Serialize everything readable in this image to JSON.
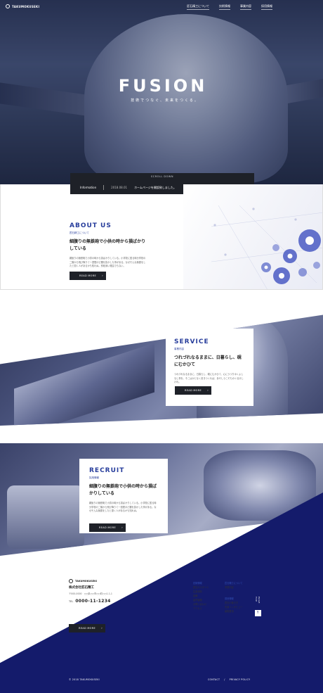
{
  "brand": {
    "logo_text": "TAKUMOKUSEKI"
  },
  "nav": {
    "items": [
      "匠石精工について",
      "技術情報",
      "事業内容",
      "採用情報"
    ]
  },
  "hero": {
    "title": "FUSION",
    "subtitle": "技術でつなぐ、未来をつくる。",
    "scroll_label": "SCROLL DOWN",
    "info_label": "Information",
    "info_date": "2018.08.01",
    "info_text": "ホームページを開設致しました。"
  },
  "about": {
    "title": "ABOUT US",
    "kicker": "匠石精工について",
    "heading": "細腹りの無鉄砲で小供の時から損ばかりしている",
    "body": "親譲りの無鉄砲で小供の時から損ばかりしている。小学校に居る時分学校の二階から飛び降りて一週間ほど腰を抜かした事がある。なぜそんな無闇をしたと聞く人があるかも知れぬ。別段深い理由でもない。",
    "button": "READ MORE"
  },
  "service": {
    "title": "SERVICE",
    "kicker": "事業内容",
    "heading": "つれづれなるままに、日暮らし、硯にむかひて",
    "body": "つれづれなるままに、日暮らし、硯にむかひて、心にうつりゆくよしなし事を、そこはかとなく書きつくれば、あやしうこそものぐるほしけれ。",
    "button": "READ MORE"
  },
  "recruit": {
    "title": "RECRUIT",
    "kicker": "採用情報",
    "heading": "細腹りの無鉄砲で小供の時から損ばかりしている",
    "body": "親譲りの無鉄砲で小供の時から損ばかりしている。小学校に居る時分学校の二階から飛び降りて一週間ほど腰を抜かした事がある。なぜそんな無闇をしたと聞く人があるかも知れぬ。",
    "button": "READ MORE"
  },
  "footer": {
    "logo_text": "TAKUMOKUSEKI",
    "company": "株式会社匠石精工",
    "address": "〒000-0000　○○県○○市○○町○○1-1-1",
    "tel_label": "TEL",
    "tel": "0000-11-1234",
    "button": "READ MORE",
    "col1": {
      "head": "技術情報",
      "items": [
        "匠石のスタイル",
        "生産体制",
        "設備",
        "品質管理",
        "お問い合わせ",
        "アクセス"
      ]
    },
    "col2": {
      "head": "匠石精工について",
      "items": [
        "事業内容"
      ]
    },
    "col3": {
      "head": "採用情報",
      "items": [
        "匠石の働き方",
        "先輩インタビュー",
        "募集要項"
      ]
    },
    "pagetop": "PAGE TOP",
    "copyright": "© 2018 TAKUMOKUSEKI",
    "contact": "CONTACT",
    "privacy": "PRIVACY POLICY"
  }
}
